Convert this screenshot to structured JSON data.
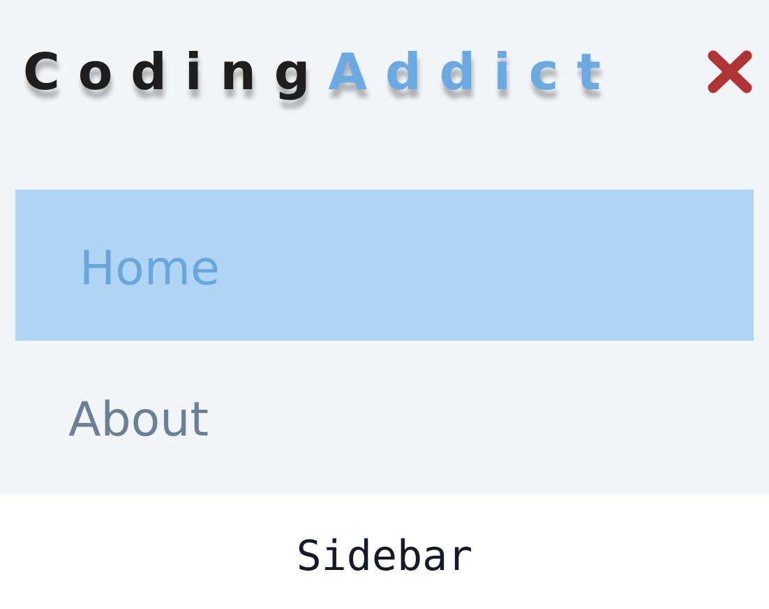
{
  "sidebar": {
    "brand": {
      "part1": "Coding",
      "part2": "Addict"
    },
    "close_icon": "close-icon",
    "items": [
      {
        "label": "Home",
        "active": true
      },
      {
        "label": "About",
        "active": false
      }
    ]
  },
  "caption": "Sidebar",
  "colors": {
    "sidebar_bg": "#f1f5f8",
    "brand_dark": "#1e1e1e",
    "brand_accent": "#6aa9e2",
    "active_bg": "#b0d4f4",
    "active_text": "#68a6e0",
    "muted_text": "#6b7f96",
    "close_red": "#b03434"
  }
}
